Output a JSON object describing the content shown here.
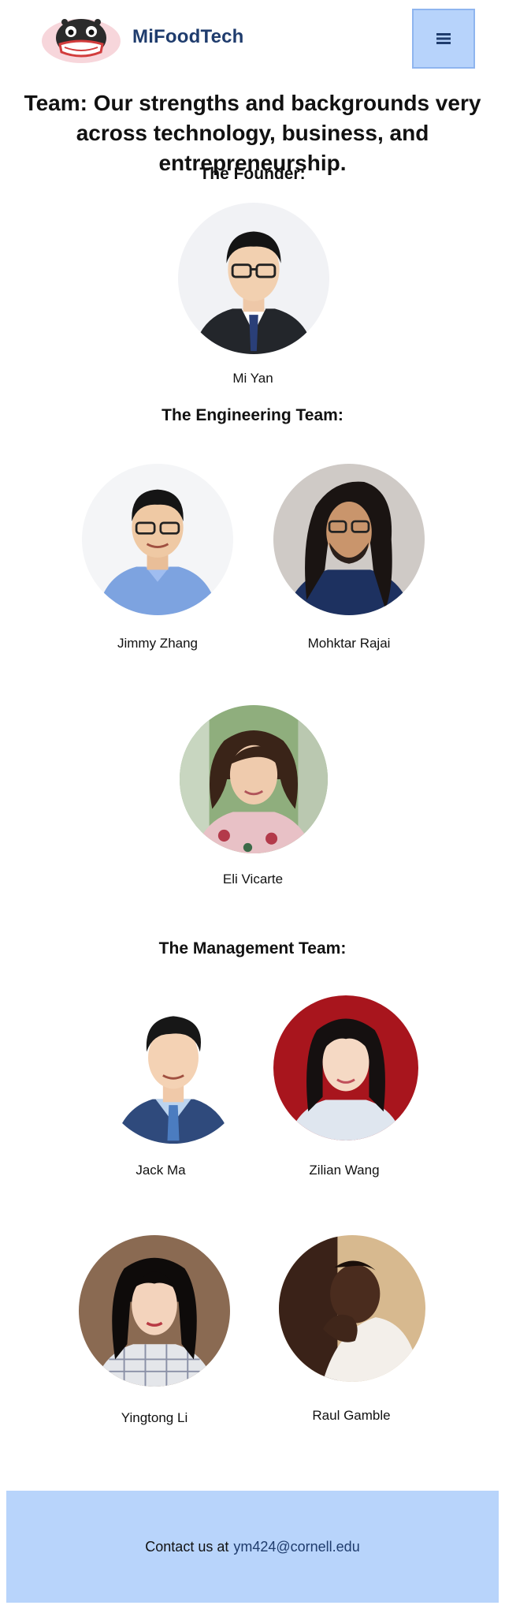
{
  "header": {
    "brand": "MiFoodTech",
    "menu_icon": "hamburger-icon",
    "logo_icon": "robot-mascot-logo"
  },
  "team_heading": "Team: Our strengths and backgrounds very across technology, business, and entrepreneurship.",
  "sections": {
    "founder": {
      "title": "The Founder:",
      "members": [
        {
          "name": "Mi Yan"
        }
      ]
    },
    "engineering": {
      "title": "The Engineering Team:",
      "members": [
        {
          "name": "Jimmy Zhang"
        },
        {
          "name": "Mohktar Rajai"
        },
        {
          "name": "Eli Vicarte"
        }
      ]
    },
    "management": {
      "title": "The Management Team:",
      "members": [
        {
          "name": "Jack Ma"
        },
        {
          "name": "Zilian Wang"
        },
        {
          "name": "Yingtong Li"
        },
        {
          "name": "Raul Gamble"
        }
      ]
    }
  },
  "footer": {
    "contact_prefix": "Contact us at",
    "email": "ym424@cornell.edu"
  }
}
